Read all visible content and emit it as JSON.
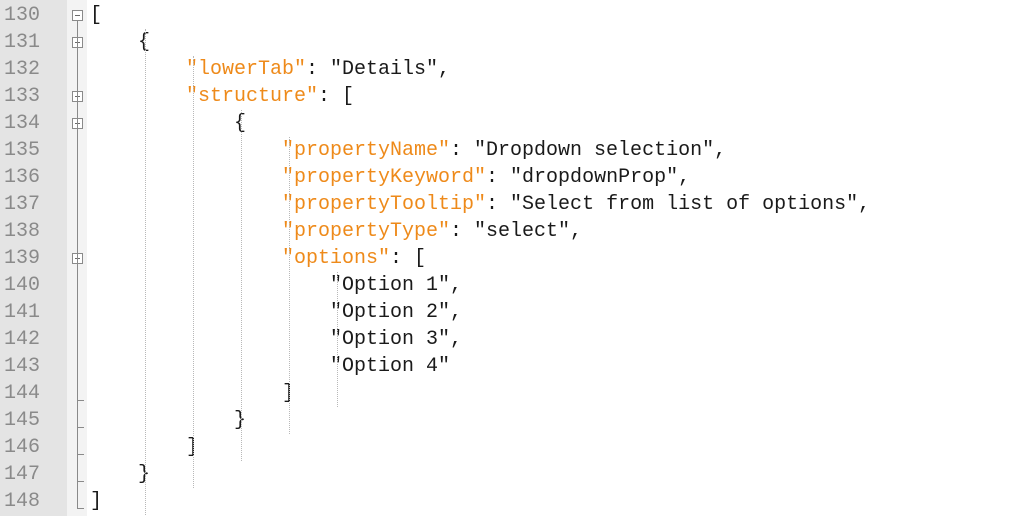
{
  "editor": {
    "lines": [
      {
        "n": "130",
        "indent": 0,
        "tokens": [
          {
            "t": "[",
            "c": "p"
          }
        ],
        "fold": "box"
      },
      {
        "n": "131",
        "indent": 1,
        "tokens": [
          {
            "t": "{",
            "c": "p"
          }
        ],
        "fold": "box"
      },
      {
        "n": "132",
        "indent": 2,
        "tokens": [
          {
            "t": "\"lowerTab\"",
            "c": "k"
          },
          {
            "t": ": \"Details\",",
            "c": "p"
          }
        ],
        "fold": "line"
      },
      {
        "n": "133",
        "indent": 2,
        "tokens": [
          {
            "t": "\"structure\"",
            "c": "k"
          },
          {
            "t": ": [",
            "c": "p"
          }
        ],
        "fold": "box"
      },
      {
        "n": "134",
        "indent": 3,
        "tokens": [
          {
            "t": "{",
            "c": "p"
          }
        ],
        "fold": "box"
      },
      {
        "n": "135",
        "indent": 4,
        "tokens": [
          {
            "t": "\"propertyName\"",
            "c": "k"
          },
          {
            "t": ": \"Dropdown selection\",",
            "c": "p"
          }
        ],
        "fold": "line"
      },
      {
        "n": "136",
        "indent": 4,
        "tokens": [
          {
            "t": "\"propertyKeyword\"",
            "c": "k"
          },
          {
            "t": ": \"dropdownProp\",",
            "c": "p"
          }
        ],
        "fold": "line"
      },
      {
        "n": "137",
        "indent": 4,
        "tokens": [
          {
            "t": "\"propertyTooltip\"",
            "c": "k"
          },
          {
            "t": ": \"Select from list of options\",",
            "c": "p"
          }
        ],
        "fold": "line"
      },
      {
        "n": "138",
        "indent": 4,
        "tokens": [
          {
            "t": "\"propertyType\"",
            "c": "k"
          },
          {
            "t": ": \"select\",",
            "c": "p"
          }
        ],
        "fold": "line"
      },
      {
        "n": "139",
        "indent": 4,
        "tokens": [
          {
            "t": "\"options\"",
            "c": "k"
          },
          {
            "t": ": [",
            "c": "p"
          }
        ],
        "fold": "box"
      },
      {
        "n": "140",
        "indent": 5,
        "tokens": [
          {
            "t": "\"Option 1\",",
            "c": "p"
          }
        ],
        "fold": "line"
      },
      {
        "n": "141",
        "indent": 5,
        "tokens": [
          {
            "t": "\"Option 2\",",
            "c": "p"
          }
        ],
        "fold": "line"
      },
      {
        "n": "142",
        "indent": 5,
        "tokens": [
          {
            "t": "\"Option 3\",",
            "c": "p"
          }
        ],
        "fold": "line"
      },
      {
        "n": "143",
        "indent": 5,
        "tokens": [
          {
            "t": "\"Option 4\"",
            "c": "p"
          }
        ],
        "fold": "line"
      },
      {
        "n": "144",
        "indent": 4,
        "tokens": [
          {
            "t": "]",
            "c": "p"
          }
        ],
        "fold": "end"
      },
      {
        "n": "145",
        "indent": 3,
        "tokens": [
          {
            "t": "}",
            "c": "p"
          }
        ],
        "fold": "end"
      },
      {
        "n": "146",
        "indent": 2,
        "tokens": [
          {
            "t": "]",
            "c": "p"
          }
        ],
        "fold": "end"
      },
      {
        "n": "147",
        "indent": 1,
        "tokens": [
          {
            "t": "}",
            "c": "p"
          }
        ],
        "fold": "end"
      },
      {
        "n": "148",
        "indent": 0,
        "tokens": [
          {
            "t": "]",
            "c": "p"
          }
        ],
        "fold": "last"
      }
    ]
  },
  "colors": {
    "key": "#ee8a1a",
    "text": "#1a1a1a",
    "line_number": "#8a8a8a",
    "gutter": "#e4e4e4"
  }
}
